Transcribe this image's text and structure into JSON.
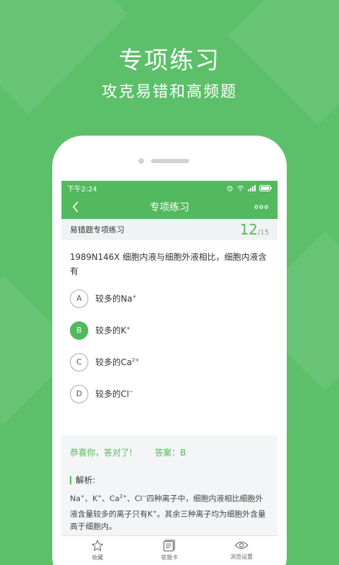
{
  "promo": {
    "title": "专项练习",
    "subtitle": "攻克易错和高频题"
  },
  "status_bar": {
    "time": "下午2:24",
    "icons": [
      "alarm-icon",
      "wifi-icon",
      "signal-icon",
      "battery-icon"
    ]
  },
  "app_bar": {
    "title": "专项练习",
    "back_icon": "chevron-left-icon",
    "more_icon": "more-dots-icon"
  },
  "question_header": {
    "label": "易错题专项练习",
    "current": "12",
    "separator": "/",
    "total": "15"
  },
  "question": {
    "text": "1989N146X 细胞内液与细胞外液相比，细胞内液含有"
  },
  "options": [
    {
      "letter": "A",
      "text": "较多的Na",
      "sup": "+",
      "correct": false
    },
    {
      "letter": "B",
      "text": "较多的K",
      "sup": "+",
      "correct": true
    },
    {
      "letter": "C",
      "text": "较多的Ca",
      "sup": "2+",
      "correct": false
    },
    {
      "letter": "D",
      "text": "较多的Cl",
      "sup": "−",
      "correct": false
    }
  ],
  "result": {
    "message": "恭喜你，答对了!",
    "answer": "答案：B"
  },
  "analysis": {
    "title": "解析:",
    "text_parts": [
      "Na",
      "+",
      "、K",
      "+",
      "、Ca",
      "2+",
      "、Cl",
      "−",
      "四种离子中，细胞内液相比细胞外液含量较多的离子只有K",
      "+",
      "。其余三种离子均为细胞外含量高于细胞内。"
    ]
  },
  "tabs": [
    {
      "label": "收藏",
      "icon": "star-icon"
    },
    {
      "label": "答题卡",
      "icon": "answer-card-icon"
    },
    {
      "label": "浏览设置",
      "icon": "eye-icon"
    }
  ],
  "colors": {
    "background": "#5cc06a",
    "accent": "#52b95e",
    "header_bg": "#f1f2f3"
  }
}
